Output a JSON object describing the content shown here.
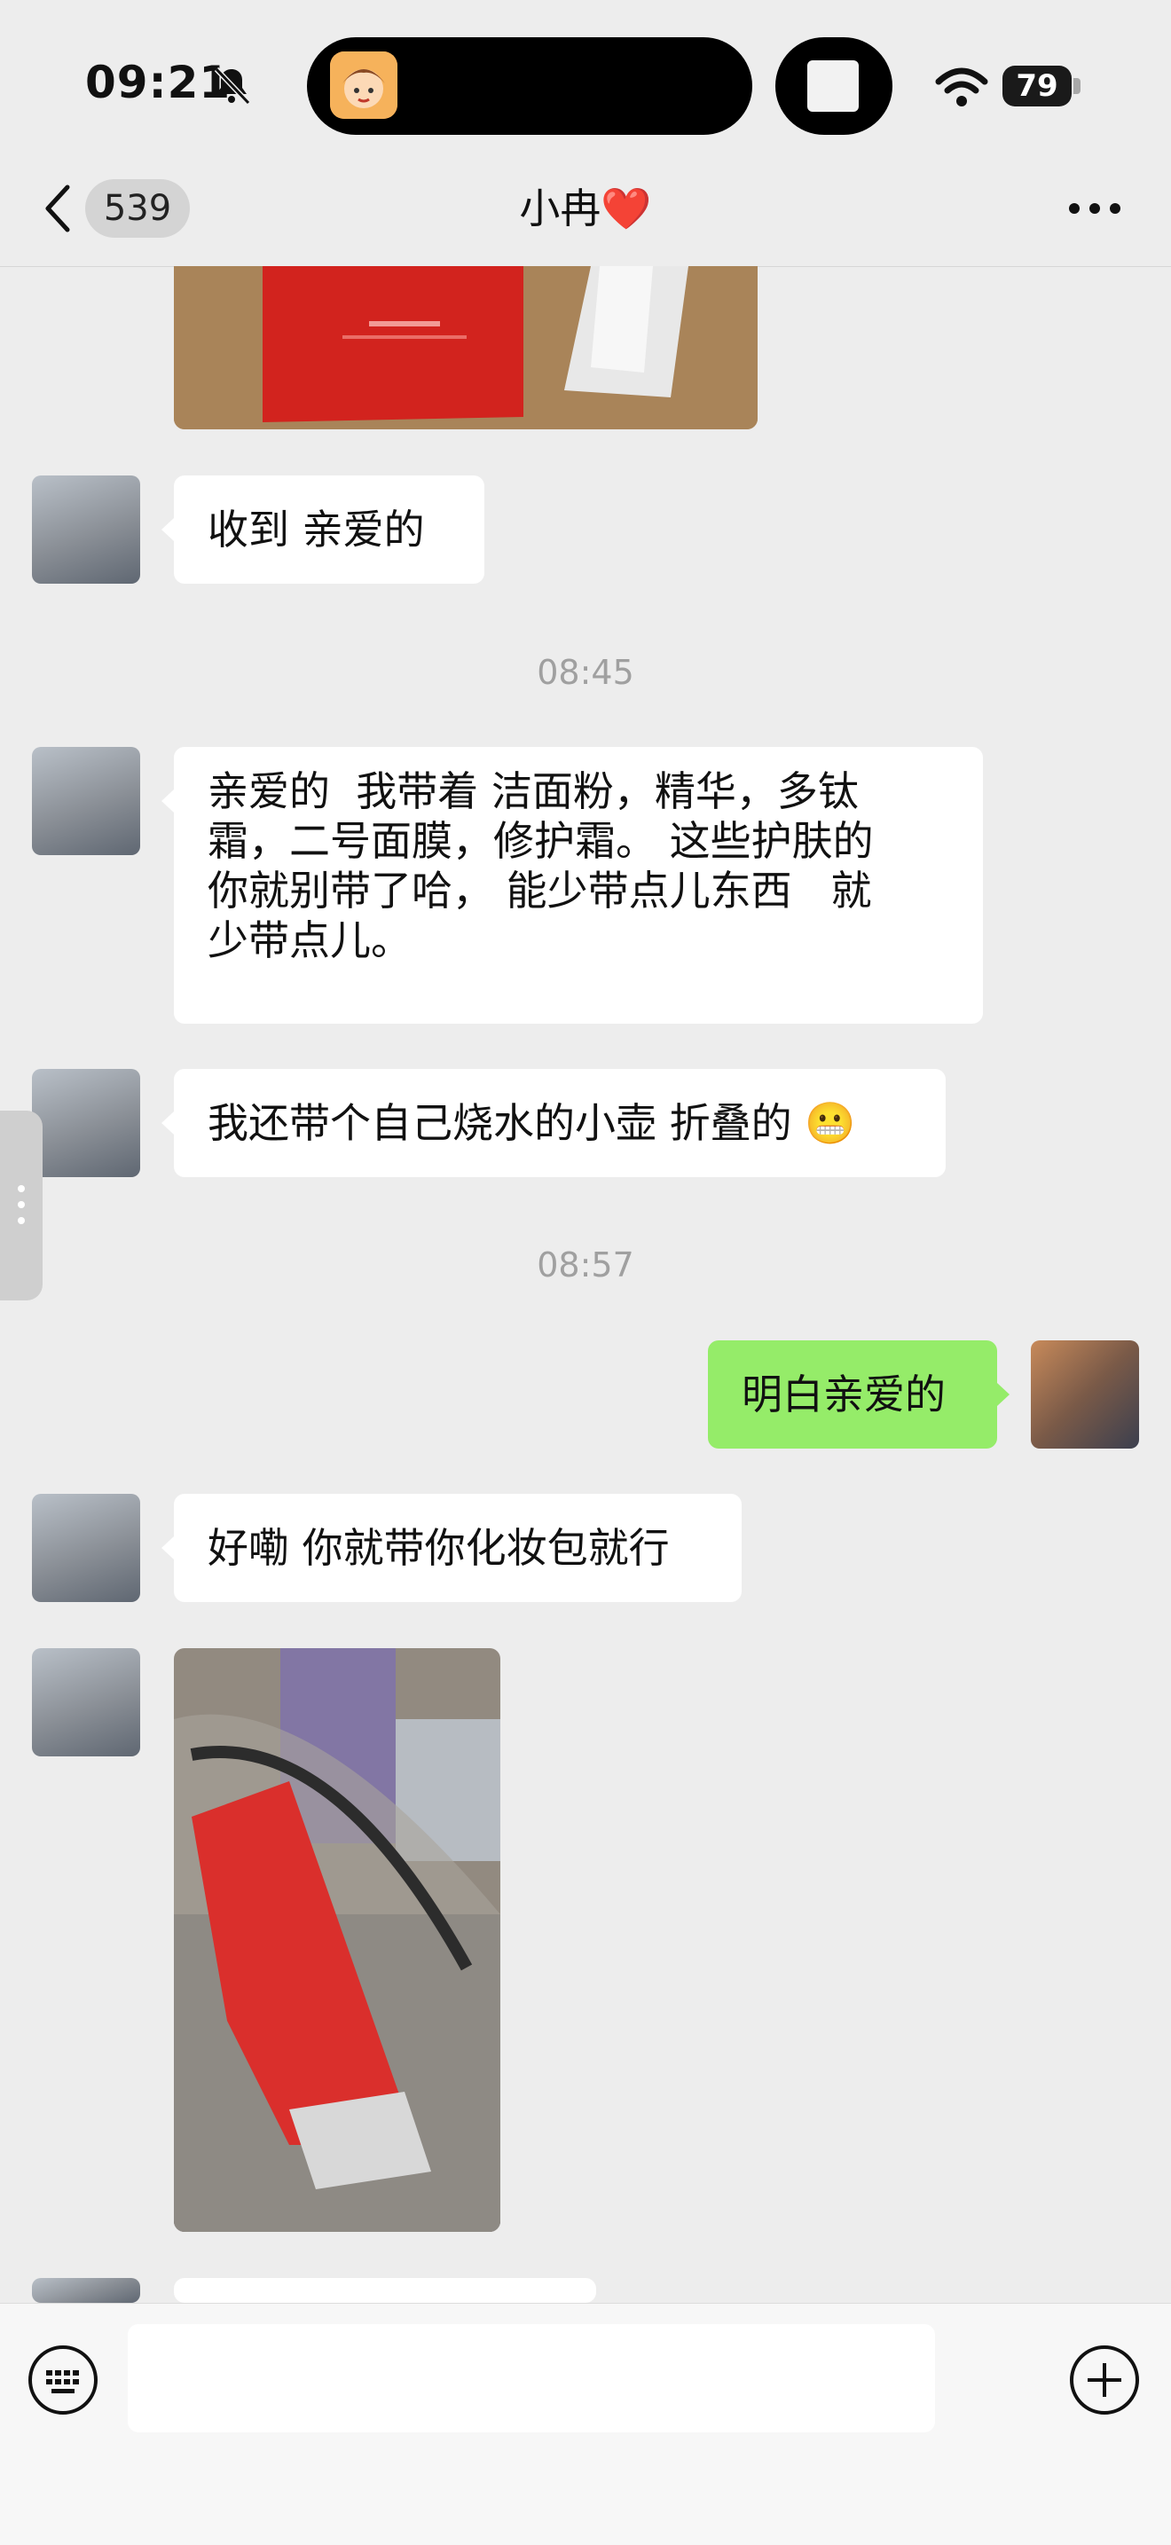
{
  "status_bar": {
    "time": "09:21",
    "battery": "79",
    "icons": [
      "bell-muted-icon",
      "wifi-icon",
      "battery-icon"
    ]
  },
  "nav": {
    "unread_count": "539",
    "title": "小冉❤️",
    "icons": [
      "back-chevron-icon",
      "more-dots-icon"
    ]
  },
  "messages": [
    {
      "type": "image",
      "sender": "them",
      "content": "photo of red skincare box and white bottle (cropped)"
    },
    {
      "type": "text",
      "sender": "them",
      "text": "收到 亲爱的"
    },
    {
      "type": "timestamp",
      "text": "08:45"
    },
    {
      "type": "text",
      "sender": "them",
      "text": "亲爱的  我带着 洁面粉，精华，多钛\n霜，二号面膜，修护霜。 这些护肤的\n你就别带了哈， 能少带点儿东西   就\n少带点儿。"
    },
    {
      "type": "text",
      "sender": "them",
      "text": "我还带个自己烧水的小壶 折叠的 😬"
    },
    {
      "type": "timestamp",
      "text": "08:57"
    },
    {
      "type": "text",
      "sender": "me",
      "text": "明白亲爱的"
    },
    {
      "type": "text",
      "sender": "them",
      "text": "好嘞 你就带你化妆包就行"
    },
    {
      "type": "image",
      "sender": "them",
      "content": "photo of red bottle inside clear cosmetic bag"
    }
  ],
  "input": {
    "value": "",
    "placeholder": "",
    "icons": [
      "keyboard-icon",
      "plus-circle-icon"
    ]
  },
  "colors": {
    "background": "#ededed",
    "their_bubble": "#ffffff",
    "my_bubble": "#95ec69",
    "timestamp": "#a0a0a0"
  }
}
